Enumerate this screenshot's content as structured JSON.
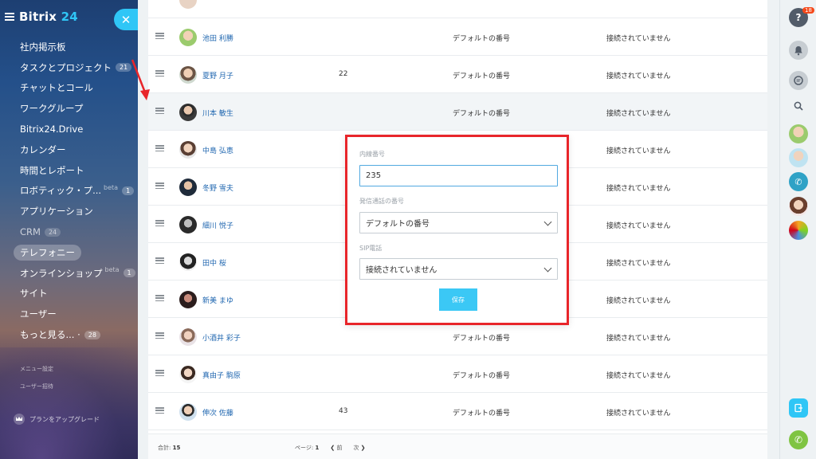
{
  "sidebar": {
    "logo_text": "Bitrix",
    "logo_num": "24",
    "close_symbol": "✕",
    "items": [
      {
        "label": "社内掲示板",
        "badge": "",
        "beta": ""
      },
      {
        "label": "タスクとプロジェクト",
        "badge": "21",
        "beta": ""
      },
      {
        "label": "チャットとコール",
        "badge": "",
        "beta": ""
      },
      {
        "label": "ワークグループ",
        "badge": "",
        "beta": ""
      },
      {
        "label": "Bitrix24.Drive",
        "badge": "",
        "beta": ""
      },
      {
        "label": "カレンダー",
        "badge": "",
        "beta": ""
      },
      {
        "label": "時間とレポート",
        "badge": "",
        "beta": ""
      },
      {
        "label": "ロボティック・プ...",
        "badge": "1",
        "beta": "beta"
      },
      {
        "label": "アプリケーション",
        "badge": "",
        "beta": ""
      },
      {
        "label": "CRM",
        "badge": "24",
        "beta": ""
      },
      {
        "label": "テレフォニー",
        "badge": "",
        "beta": ""
      },
      {
        "label": "オンラインショップ",
        "badge": "1",
        "beta": "beta"
      },
      {
        "label": "サイト",
        "badge": "",
        "beta": ""
      },
      {
        "label": "ユーザー",
        "badge": "",
        "beta": ""
      },
      {
        "label": "もっと見る... ·",
        "badge": "28",
        "beta": ""
      }
    ],
    "sub_links": [
      "メニュー設定",
      "ユーザー招待"
    ],
    "upgrade_label": "プランをアップグレード"
  },
  "rows": [
    {
      "name": "池田 利勝",
      "ext": "",
      "number": "デフォルトの番号",
      "sip": "接続されていません"
    },
    {
      "name": "夏野 月子",
      "ext": "22",
      "number": "デフォルトの番号",
      "sip": "接続されていません"
    },
    {
      "name": "川本 敏生",
      "ext": "",
      "number": "デフォルトの番号",
      "sip": "接続されていません"
    },
    {
      "name": "中島 弘恵",
      "ext": "",
      "number": "",
      "sip": "接続されていません"
    },
    {
      "name": "冬野 雪夫",
      "ext": "",
      "number": "",
      "sip": "接続されていません"
    },
    {
      "name": "細川 悦子",
      "ext": "",
      "number": "",
      "sip": "接続されていません"
    },
    {
      "name": "田中 桜",
      "ext": "",
      "number": "",
      "sip": "接続されていません"
    },
    {
      "name": "新美 まゆ",
      "ext": "",
      "number": "",
      "sip": "接続されていません"
    },
    {
      "name": "小酒井 彩子",
      "ext": "",
      "number": "デフォルトの番号",
      "sip": "接続されていません"
    },
    {
      "name": "真由子 駒原",
      "ext": "",
      "number": "デフォルトの番号",
      "sip": "接続されていません"
    },
    {
      "name": "伸次 佐藤",
      "ext": "43",
      "number": "デフォルトの番号",
      "sip": "接続されていません"
    }
  ],
  "footer": {
    "total_label": "合計:",
    "total_value": "15",
    "page_label": "ページ:",
    "page_value": "1",
    "prev_label": "前",
    "next_label": "次"
  },
  "popup": {
    "ext_label": "内線番号",
    "ext_value": "235",
    "outgoing_label": "発信通話の番号",
    "outgoing_value": "デフォルトの番号",
    "sip_label": "SIP電話",
    "sip_value": "接続されていません",
    "save_label": "保存"
  },
  "rightbar": {
    "help_badge": "18"
  },
  "colors": {
    "accent": "#2fc6f6",
    "link": "#2067b0",
    "highlight_border": "#e8252a",
    "call_green": "#7fc442"
  }
}
